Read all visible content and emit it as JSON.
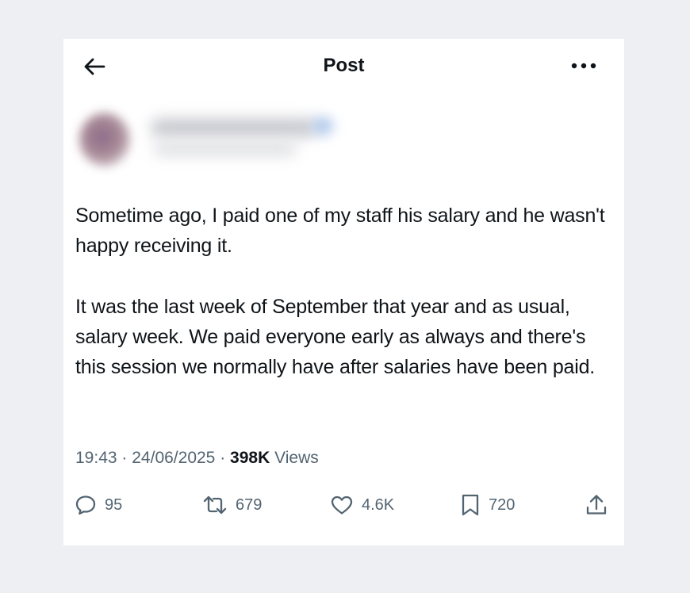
{
  "header": {
    "title": "Post",
    "back_icon": "arrow-left-icon",
    "more_icon": "more-horizontal-icon"
  },
  "post": {
    "paragraphs": [
      "Sometime ago, I paid one of my staff his salary and he wasn't happy receiving it.",
      "It was the last week of September that year and as usual, salary week. We paid everyone early as always and there's this session we normally have after salaries have been paid."
    ],
    "time": "19:43",
    "separator": "·",
    "date": "24/06/2025",
    "views_count": "398K",
    "views_label": "Views"
  },
  "actions": {
    "replies": "95",
    "reposts": "679",
    "likes": "4.6K",
    "bookmarks": "720"
  },
  "colors": {
    "background": "#eeeff3",
    "card": "#ffffff",
    "text": "#0f1419",
    "muted": "#536471"
  }
}
